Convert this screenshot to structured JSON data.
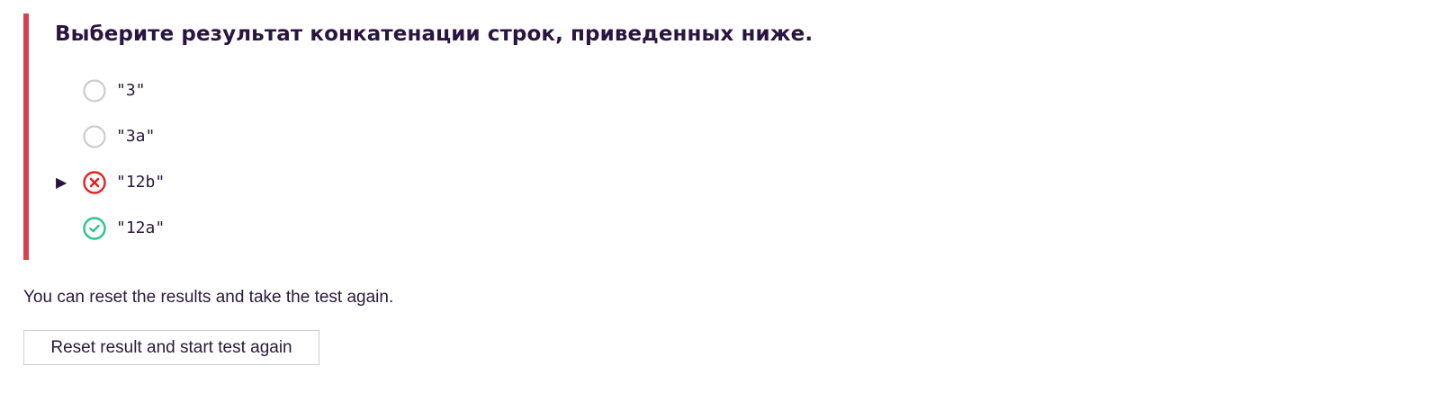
{
  "question": {
    "title": "Выберите результат конкатенации строк, приведенных ниже.",
    "options": [
      {
        "label": "\"3\"",
        "state": "unselected",
        "selected": false
      },
      {
        "label": "\"3a\"",
        "state": "unselected",
        "selected": false
      },
      {
        "label": "\"12b\"",
        "state": "incorrect",
        "selected": true
      },
      {
        "label": "\"12a\"",
        "state": "correct",
        "selected": false
      }
    ],
    "selected_marker": "▶"
  },
  "reset": {
    "message": "You can reset the results and take the test again.",
    "button_label": "Reset result and start test again"
  },
  "colors": {
    "accent_bar": "#d6404f",
    "incorrect": "#e02424",
    "correct": "#2fc38a",
    "unselected": "#cccccc"
  },
  "icons": {
    "unselected": "radio-empty-icon",
    "incorrect": "x-circle-icon",
    "correct": "check-circle-icon"
  }
}
